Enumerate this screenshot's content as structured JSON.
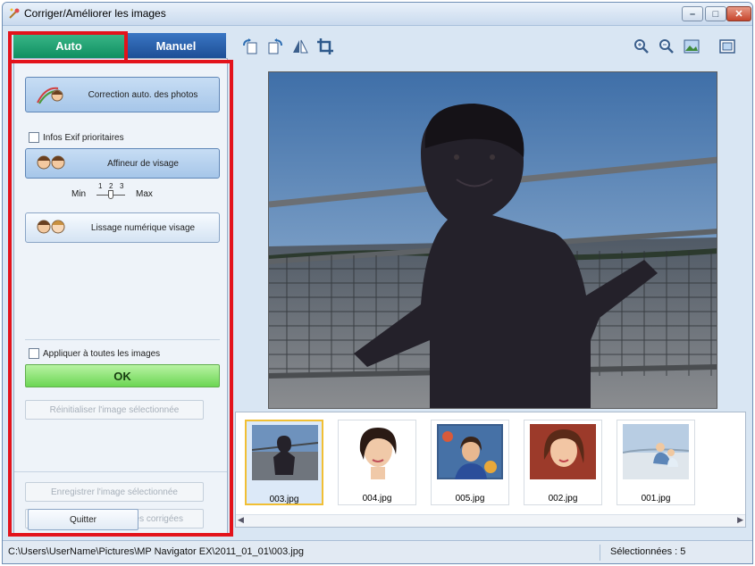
{
  "window": {
    "title": "Corriger/Améliorer les images"
  },
  "tabs": [
    {
      "label": "Auto"
    },
    {
      "label": "Manuel"
    }
  ],
  "panel": {
    "auto_photo_label": "Correction auto. des photos",
    "exif_label": "Infos Exif prioritaires",
    "face_sharpener_label": "Affineur de visage",
    "slider": {
      "min_label": "Min",
      "max_label": "Max",
      "ticks": [
        "1",
        "2",
        "3"
      ],
      "level": 2
    },
    "digital_face_label": "Lissage numérique visage",
    "apply_all_label": "Appliquer à toutes les images",
    "ok_label": "OK",
    "reset_label": "Réinitialiser l'image sélectionnée",
    "save_selected_label": "Enregistrer l'image sélectionnée",
    "save_all_label": "Enreg. toutes les images corrigées",
    "quit_label": "Quitter"
  },
  "toolbar": {
    "icons": [
      "rotate-left-icon",
      "rotate-right-icon",
      "flip-icon",
      "crop-icon",
      "zoom-in-icon",
      "zoom-out-icon",
      "full-view-icon",
      "fit-window-icon"
    ]
  },
  "thumbnails": [
    {
      "label": "003.jpg",
      "selected": true
    },
    {
      "label": "004.jpg",
      "selected": false
    },
    {
      "label": "005.jpg",
      "selected": false
    },
    {
      "label": "002.jpg",
      "selected": false
    },
    {
      "label": "001.jpg",
      "selected": false
    }
  ],
  "status": {
    "path": "C:\\Users\\UserName\\Pictures\\MP Navigator EX\\2011_01_01\\003.jpg",
    "selected": "Sélectionnées : 5"
  },
  "colors": {
    "highlight_outline": "#e3131b",
    "auto_tab": "#1aa06f",
    "manual_tab": "#2a5fa8",
    "ok_button": "#7edc64"
  }
}
